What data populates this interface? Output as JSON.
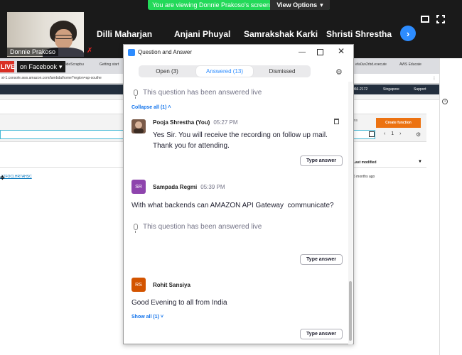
{
  "zoom": {
    "share_banner": "You are viewing Donnie Prakoso's screen",
    "view_options": "View Options",
    "self_name": "Donnie Prakoso",
    "participants": [
      "Dilli Maharjan",
      "Anjani Phuyal",
      "Samrakshak Karki",
      "Shristi Shrestha"
    ]
  },
  "browser": {
    "live": "LIVE",
    "on_facebook": "on Facebook",
    "tabs": [
      "SlideScrapbu",
      "Getting start",
      "efa0uv2rbd.execute",
      "AWS Educate"
    ],
    "url": "st-1.console.aws.amazon.com/lambda/home?region=ap-southe",
    "aws_nav": {
      "account": "066-2172",
      "region": "Singapore",
      "support": "Support"
    },
    "actions": "ions",
    "create_function": "Create function",
    "page_number": "1",
    "last_modified": "Last modified",
    "function_name": "-1TFOCLHR7AHSC",
    "modified_ago": "6 months ago"
  },
  "qa": {
    "title": "Question and Answer",
    "tabs": [
      {
        "label": "Open (3)"
      },
      {
        "label": "Answered (13)"
      },
      {
        "label": "Dismissed"
      }
    ],
    "answered_live": "This question has been answered live",
    "collapse_all": "Collapse all (1)",
    "show_all": "Show all (1)",
    "type_answer": "Type answer",
    "reply": {
      "author": "Pooja Shrestha (You)",
      "time": "05:27 PM",
      "text": "Yes Sir. You will receive the recording on follow up mail. Thank you for attending."
    },
    "questions": [
      {
        "initials": "SR",
        "avatar_color": "#8e44ad",
        "author": "Sampada Regmi",
        "time": "05:39 PM",
        "text": "With what backends can AMAZON API Gateway  communicate?"
      },
      {
        "initials": "RS",
        "avatar_color": "#d35400",
        "author": "Rohit Sansiya",
        "time": "",
        "text": "Good Evening to all from India"
      }
    ]
  },
  "colors": {
    "zoom_blue": "#2d8cff",
    "banner_green": "#23d959",
    "aws_orange": "#ec7211",
    "aws_navy": "#232f3e"
  }
}
